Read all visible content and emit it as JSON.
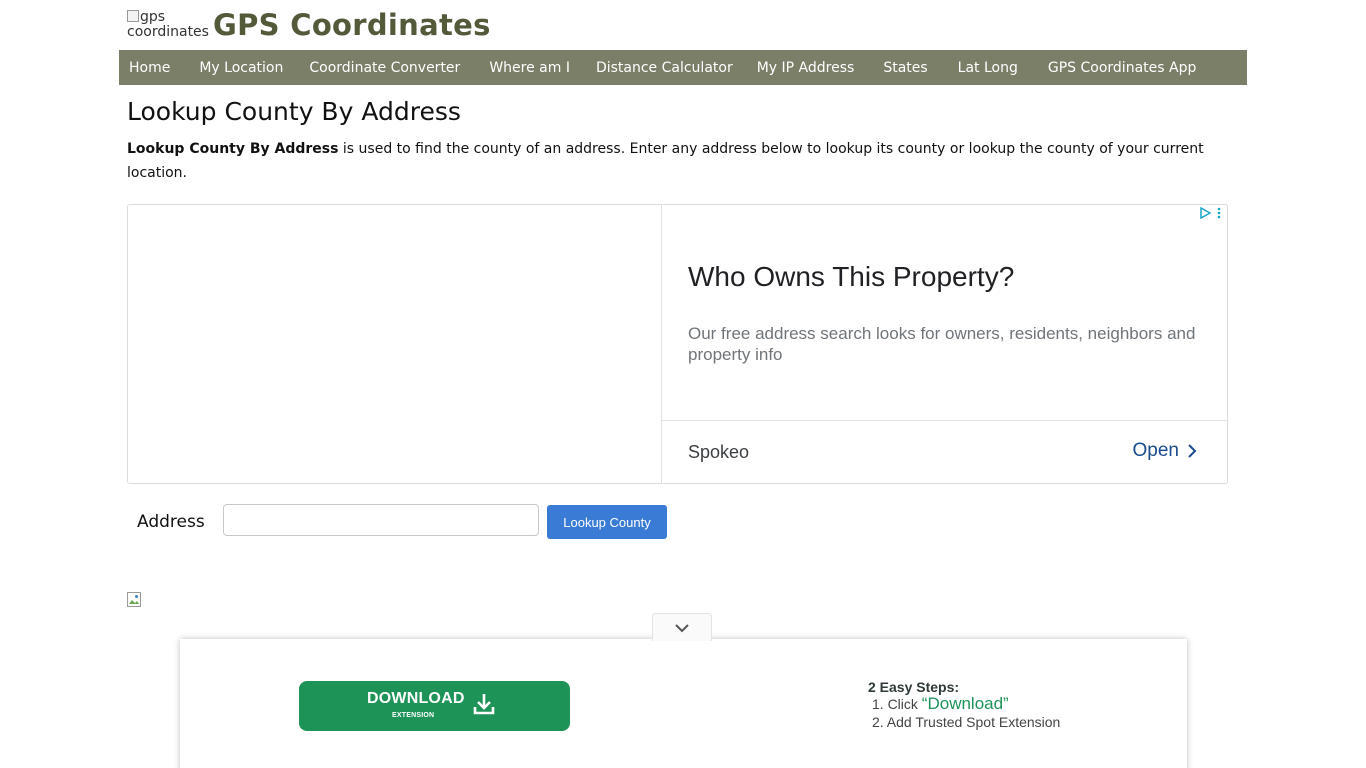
{
  "header": {
    "logo_alt": "gps coordinates",
    "site_title": "GPS Coordinates"
  },
  "nav": {
    "items": [
      {
        "label": "Home"
      },
      {
        "label": "My Location"
      },
      {
        "label": "Coordinate Converter"
      },
      {
        "label": "Where am I"
      },
      {
        "label": "Distance Calculator"
      },
      {
        "label": "My IP Address"
      },
      {
        "label": "States"
      },
      {
        "label": "Lat Long"
      },
      {
        "label": "GPS Coordinates App"
      }
    ],
    "bg_color": "#7b7f68"
  },
  "main": {
    "title": "Lookup County By Address",
    "intro_bold": "Lookup County By Address",
    "intro_rest": " is used to find the county of an address. Enter any address below to lookup its county or lookup the county of your current location."
  },
  "ad": {
    "headline": "Who Owns This Property?",
    "body": "Our free address search looks for owners, residents, neighbors and property info",
    "advertiser": "Spokeo",
    "cta": "Open",
    "icons": [
      "ad-choices-icon",
      "ad-menu-icon",
      "chevron-right-icon"
    ]
  },
  "form": {
    "address_label": "Address",
    "address_value": "",
    "address_placeholder": "",
    "button_label": "Lookup County",
    "button_color": "#3a7bd5"
  },
  "extension": {
    "download_label": "DOWNLOAD",
    "download_sub": "EXTENSION",
    "steps_title": "2 Easy Steps:",
    "step1_prefix": "1. Click ",
    "step1_highlight": "“Download”",
    "step2": "2. Add Trusted Spot Extension",
    "button_color": "#1e9358",
    "icons": [
      "chevron-down-icon",
      "download-icon"
    ]
  }
}
